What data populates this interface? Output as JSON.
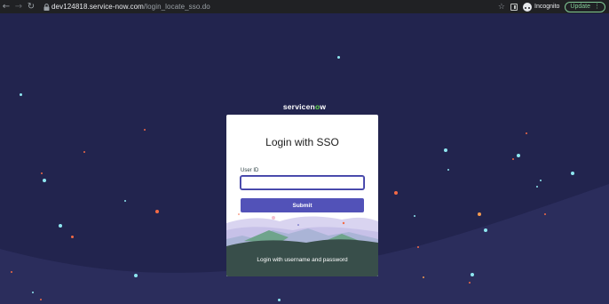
{
  "browser": {
    "url_domain": "dev124818.service-now.com",
    "url_path": "/login_locate_sso.do",
    "profile_label": "Incognito",
    "update_label": "Update"
  },
  "icons": {
    "back": "back-arrow-icon",
    "forward": "forward-arrow-icon",
    "reload": "reload-icon",
    "lock": "lock-icon",
    "bookmark": "star-icon",
    "side_panel": "side-panel-icon",
    "incognito": "incognito-icon",
    "menu": "kebab-menu-icon"
  },
  "logo": {
    "text_before": "servicen",
    "text_accent": "o",
    "text_after": "w"
  },
  "login": {
    "title": "Login with SSO",
    "userid_label": "User ID",
    "userid_value": "",
    "submit_label": "Submit",
    "alt_login_link": "Login with username and password"
  },
  "colors": {
    "page_background": "#22244e",
    "accent_button": "#5252b8",
    "logo_accent": "#62d84e",
    "update_accent": "#81c995"
  }
}
